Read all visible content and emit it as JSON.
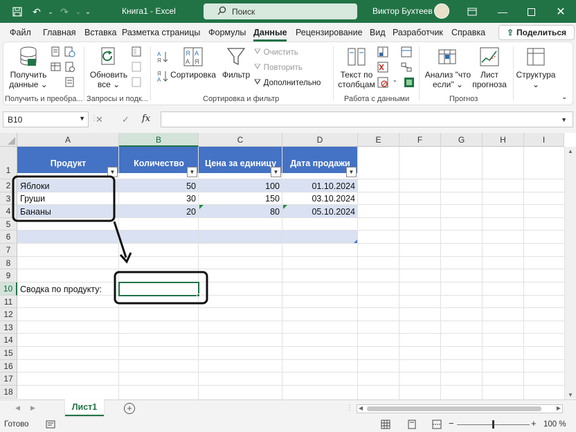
{
  "titlebar": {
    "title": "Книга1  -  Excel",
    "search_placeholder": "Поиск",
    "user_name": "Виктор Бухтеев",
    "bg_color": "#217346"
  },
  "menu": {
    "tabs": [
      "Файл",
      "Главная",
      "Вставка",
      "Разметка страницы",
      "Формулы",
      "Данные",
      "Рецензирование",
      "Вид",
      "Разработчик",
      "Справка"
    ],
    "active_tab": "Данные",
    "share_label": "Поделиться"
  },
  "ribbon": {
    "get_data_l1": "Получить",
    "get_data_l2": "данные",
    "refresh_l1": "Обновить",
    "refresh_l2": "все",
    "sort_label": "Сортировка",
    "filter_label": "Фильтр",
    "clear_label": "Очистить",
    "reapply_label": "Повторить",
    "advanced_label": "Дополнительно",
    "text_to_cols_l1": "Текст по",
    "text_to_cols_l2": "столбцам",
    "whatif_l1": "Анализ \"что",
    "whatif_l2": "если\"",
    "forecast_l1": "Лист",
    "forecast_l2": "прогноза",
    "outline_label": "Структура",
    "groups": {
      "get_transform": "Получить и преобра...",
      "queries": "Запросы и подк...",
      "sort_filter": "Сортировка и фильтр",
      "data_tools": "Работа с данными",
      "forecast": "Прогноз"
    }
  },
  "formula_bar": {
    "name_box": "B10",
    "fx": "fx",
    "formula": ""
  },
  "grid": {
    "columns": [
      "A",
      "B",
      "C",
      "D",
      "E",
      "F",
      "G",
      "H",
      "I"
    ],
    "selected_column": "B",
    "rows": [
      "1",
      "2",
      "3",
      "4",
      "5",
      "6",
      "7",
      "8",
      "9",
      "10",
      "11",
      "12",
      "13",
      "14",
      "15",
      "16",
      "17",
      "18"
    ],
    "selected_row": "10",
    "table_headers": [
      "Продукт",
      "Количество",
      "Цена за единицу",
      "Дата продажи"
    ],
    "table_rows": [
      [
        "Яблоки",
        "50",
        "100",
        "01.10.2024"
      ],
      [
        "Груши",
        "30",
        "150",
        "03.10.2024"
      ],
      [
        "Бананы",
        "20",
        "80",
        "05.10.2024"
      ]
    ],
    "summary_label": "Сводка по продукту:",
    "header_color": "#4472c4",
    "band_color": "#d9e1f2"
  },
  "sheets": {
    "tabs": [
      "Лист1"
    ]
  },
  "status": {
    "ready": "Готово",
    "zoom": "100 %"
  }
}
